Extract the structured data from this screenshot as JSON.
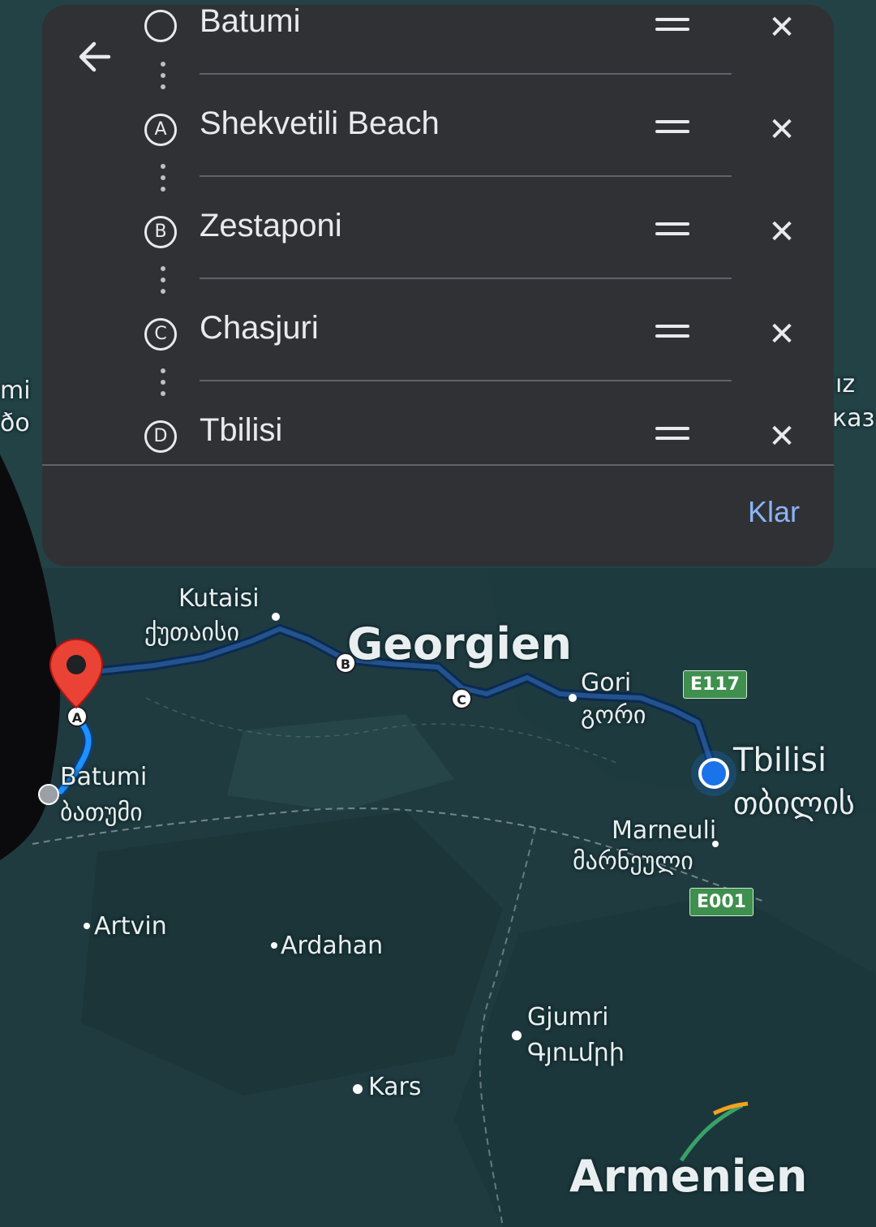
{
  "panel": {
    "back_icon": "arrow-back-icon",
    "stops": [
      {
        "marker": "",
        "label": "Batumi"
      },
      {
        "marker": "A",
        "label": "Shekvetili Beach"
      },
      {
        "marker": "B",
        "label": "Zestaponi"
      },
      {
        "marker": "C",
        "label": "Chasjuri"
      },
      {
        "marker": "D",
        "label": "Tbilisi"
      }
    ],
    "done_label": "Klar",
    "accent_color": "#8ab4f8"
  },
  "map": {
    "country_labels": [
      "Georgien",
      "Armenien"
    ],
    "cities": [
      {
        "name": "Kutaisi",
        "local": "ქუთაისი"
      },
      {
        "name": "Gori",
        "local": "გორი"
      },
      {
        "name": "Tbilisi",
        "local": "თბილის"
      },
      {
        "name": "Batumi",
        "local": "ბათუმი"
      },
      {
        "name": "Marneuli",
        "local": "მარნეული"
      },
      {
        "name": "Artvin",
        "local": ""
      },
      {
        "name": "Ardahan",
        "local": ""
      },
      {
        "name": "Gjumri",
        "local": "Գյումրի"
      },
      {
        "name": "Kars",
        "local": ""
      }
    ],
    "roads": [
      "E117",
      "E001"
    ],
    "route_markers": [
      "A",
      "B",
      "C"
    ],
    "edge_fragments": [
      "mi",
      "ðo",
      "ız",
      "каз"
    ],
    "route_color": "#1a73e8",
    "current_location_color": "#1a73e8",
    "pin_color": "#ea4335"
  }
}
